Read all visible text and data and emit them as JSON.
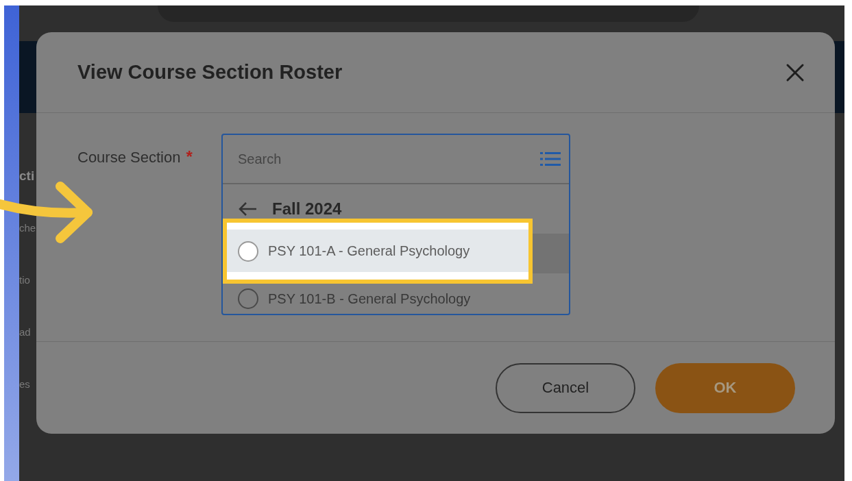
{
  "background_page": {
    "sidebar_fragments": [
      {
        "text": "cti",
        "kind": "heading"
      },
      {
        "text": "che",
        "kind": "item"
      },
      {
        "text": "tio",
        "kind": "item"
      },
      {
        "text": "ad",
        "kind": "item"
      },
      {
        "text": "es",
        "kind": "item"
      }
    ]
  },
  "dialog": {
    "title": "View Course Section Roster",
    "field": {
      "label": "Course Section",
      "required": true,
      "required_mark": "*",
      "placeholder": "Search",
      "group": "Fall 2024",
      "options": [
        {
          "label": "PSY 101-A - General Psychology",
          "selected": false,
          "highlighted": true
        },
        {
          "label": "PSY 101-B - General Psychology",
          "selected": false,
          "highlighted": false
        }
      ]
    },
    "buttons": [
      {
        "label": "Cancel",
        "kind": "secondary"
      },
      {
        "label": "OK",
        "kind": "primary"
      }
    ]
  }
}
